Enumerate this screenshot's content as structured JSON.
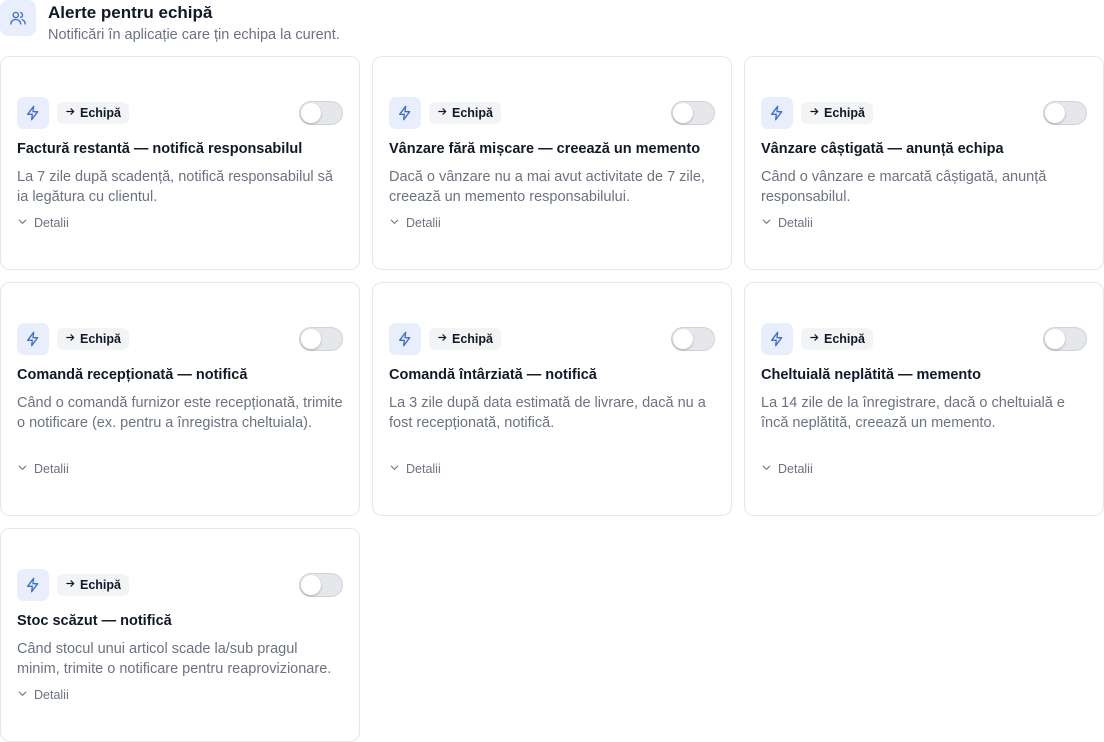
{
  "header": {
    "title": "Alerte pentru echipă",
    "subtitle": "Notificări în aplicație care țin echipa la curent."
  },
  "cards": [
    {
      "tag": "Echipă",
      "title": "Factură restantă — notifică responsabilul",
      "description": "La 7 zile după scadență, notifică responsabilul să ia legătura cu clientul.",
      "details_label": "Detalii",
      "enabled": false
    },
    {
      "tag": "Echipă",
      "title": "Vânzare fără mișcare — creează un memento",
      "description": "Dacă o vânzare nu a mai avut activitate de 7 zile, creează un memento responsabilului.",
      "details_label": "Detalii",
      "enabled": false
    },
    {
      "tag": "Echipă",
      "title": "Vânzare câștigată — anunță echipa",
      "description": "Când o vânzare e marcată câștigată, anunță responsabilul.",
      "details_label": "Detalii",
      "enabled": false
    },
    {
      "tag": "Echipă",
      "title": "Comandă recepționată — notifică",
      "description": "Când o comandă furnizor este recepționată, trimite o notificare (ex. pentru a înregistra cheltuiala).",
      "details_label": "Detalii",
      "enabled": false
    },
    {
      "tag": "Echipă",
      "title": "Comandă întârziată — notifică",
      "description": "La 3 zile după data estimată de livrare, dacă nu a fost recepționată, notifică.",
      "details_label": "Detalii",
      "enabled": false
    },
    {
      "tag": "Echipă",
      "title": "Cheltuială neplătită — memento",
      "description": "La 14 zile de la înregistrare, dacă o cheltuială e încă neplătită, creează un memento.",
      "details_label": "Detalii",
      "enabled": false
    },
    {
      "tag": "Echipă",
      "title": "Stoc scăzut — notifică",
      "description": "Când stocul unui articol scade la/sub pragul minim, trimite o notificare pentru reaprovizionare.",
      "details_label": "Detalii",
      "enabled": false
    }
  ],
  "icons": {
    "header": "users-icon",
    "card": "bolt-icon",
    "tag": "arrow-right-icon",
    "details": "chevron-down-icon"
  },
  "colors": {
    "accent": "#3b6fd4",
    "icon_bg": "#e8eefc",
    "tag_bg": "#f3f4f6",
    "toggle_off": "#e5e7eb"
  }
}
